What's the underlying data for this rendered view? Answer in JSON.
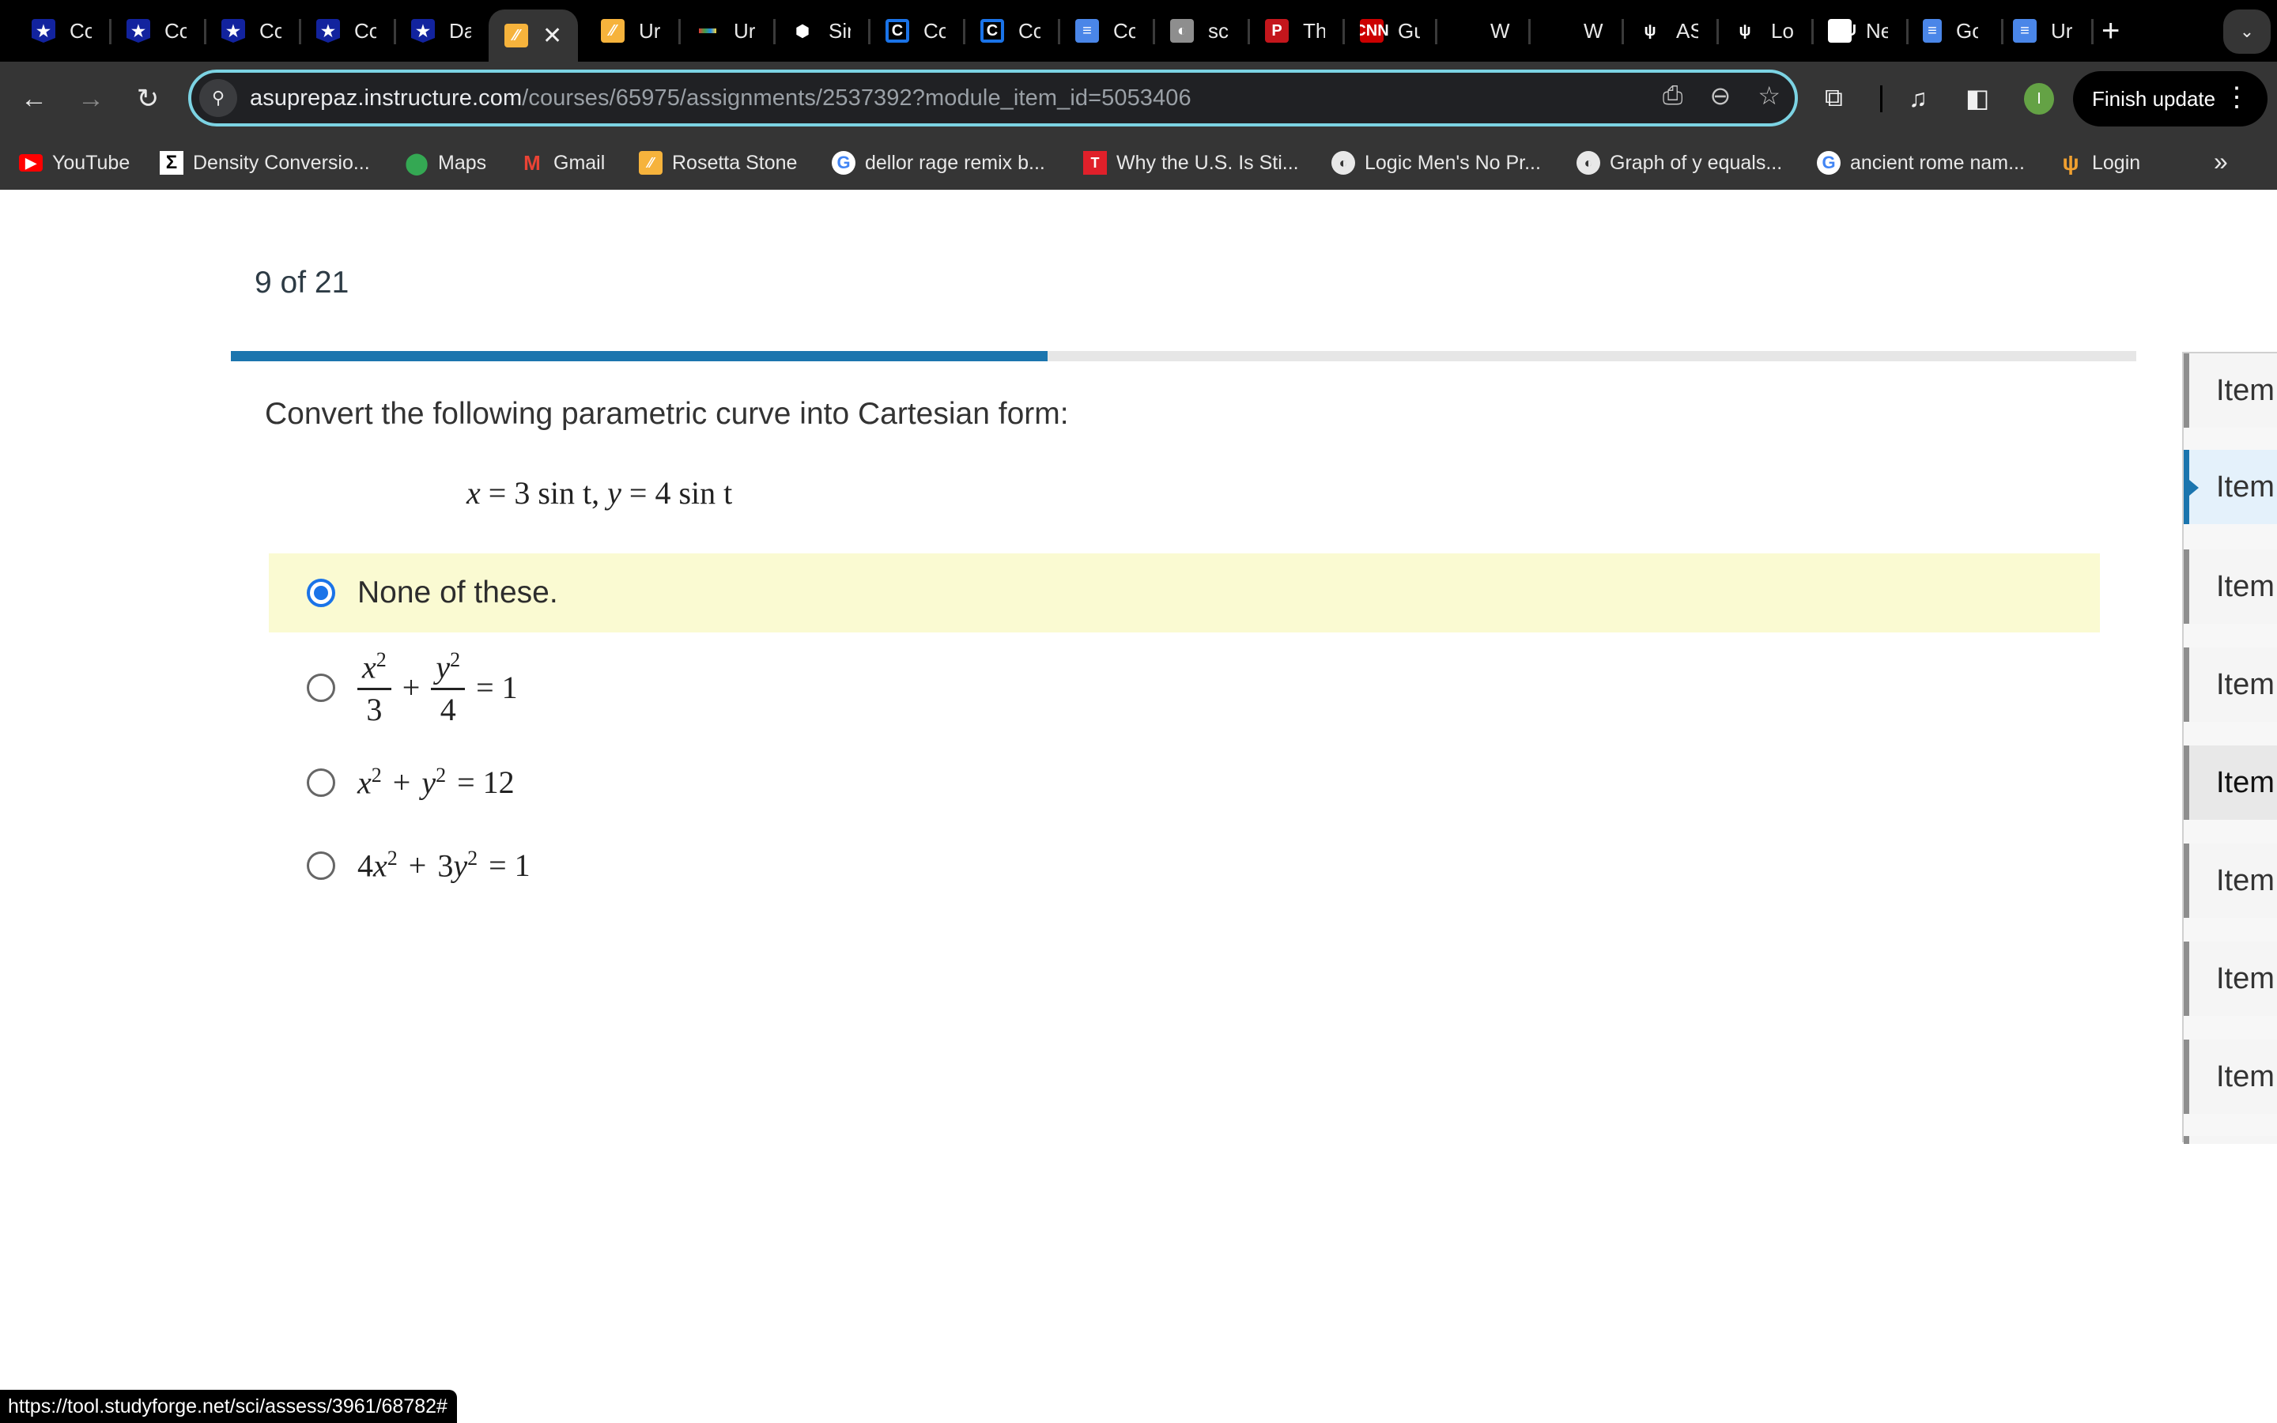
{
  "browser": {
    "tabs": [
      {
        "title": "Co",
        "icon": "canvas-star-icon",
        "active": false
      },
      {
        "title": "Co",
        "icon": "canvas-star-icon",
        "active": false
      },
      {
        "title": "Co",
        "icon": "canvas-star-icon",
        "active": false
      },
      {
        "title": "Co",
        "icon": "canvas-star-icon",
        "active": false
      },
      {
        "title": "Da",
        "icon": "canvas-star-icon",
        "active": false
      },
      {
        "title": "",
        "icon": "rosetta-stone-icon",
        "active": true
      },
      {
        "title": "Ur",
        "icon": "rosetta-stone-icon",
        "active": false
      },
      {
        "title": "Ur",
        "icon": "multicolor-bar-icon",
        "active": false
      },
      {
        "title": "Sir",
        "icon": "hexagon-cluster-icon",
        "active": false
      },
      {
        "title": "Co",
        "icon": "c-circle-icon",
        "active": false
      },
      {
        "title": "Co",
        "icon": "c-circle-icon",
        "active": false
      },
      {
        "title": "Co",
        "icon": "google-docs-icon",
        "active": false
      },
      {
        "title": "sc",
        "icon": "globe-icon",
        "active": false
      },
      {
        "title": "Th",
        "icon": "p-logo-icon",
        "active": false
      },
      {
        "title": "Gu",
        "icon": "cnn-icon",
        "active": false
      },
      {
        "title": "W",
        "icon": "blank-icon",
        "active": false
      },
      {
        "title": "W",
        "icon": "blank-icon",
        "active": false
      },
      {
        "title": "AS",
        "icon": "asu-pitchfork-icon",
        "active": false
      },
      {
        "title": "Lo",
        "icon": "asu-pitchfork-icon",
        "active": false
      },
      {
        "title": "Ne",
        "icon": "asu-logo-icon",
        "active": false
      },
      {
        "title": "Go",
        "icon": "google-docs-file-icon",
        "active": false
      },
      {
        "title": "Ur",
        "icon": "google-docs-icon",
        "active": false
      }
    ],
    "close_glyph": "✕",
    "new_tab_glyph": "+",
    "tab_search_glyph": "⌄",
    "url_host": "asuprepaz.instructure.com",
    "url_path": "/courses/65975/assignments/2537392?module_item_id=5053406",
    "finish_update_label": "Finish update",
    "profile_initial": "I",
    "bookmarks": [
      {
        "label": "YouTube",
        "icon": "youtube-icon"
      },
      {
        "label": "Density Conversio...",
        "icon": "sigma-icon"
      },
      {
        "label": "Maps",
        "icon": "maps-pin-icon"
      },
      {
        "label": "Gmail",
        "icon": "gmail-icon"
      },
      {
        "label": "Rosetta Stone",
        "icon": "rosetta-stone-icon"
      },
      {
        "label": "dellor rage remix b...",
        "icon": "google-icon"
      },
      {
        "label": "Why the U.S. Is Sti...",
        "icon": "t-logo-icon"
      },
      {
        "label": "Logic Men's No Pr...",
        "icon": "globe-icon"
      },
      {
        "label": "Graph of y equals...",
        "icon": "globe-icon"
      },
      {
        "label": "ancient rome nam...",
        "icon": "google-icon"
      },
      {
        "label": "Login",
        "icon": "asu-pitchfork-icon"
      }
    ],
    "bookmarks_overflow_glyph": "»",
    "status_url": "https://tool.studyforge.net/sci/assess/3961/68782#"
  },
  "quiz": {
    "counter": "9 of 21",
    "progress": {
      "current": 9,
      "total": 21,
      "fraction": 0.4286
    },
    "question": "Convert the following parametric curve into Cartesian form:",
    "formula": {
      "x_var": "x",
      "eq": "=",
      "x_expr": "3 sin t",
      "sep": ",",
      "y_var": "y",
      "y_expr": "4 sin t"
    },
    "answers": [
      {
        "label": "None of these.",
        "type": "text",
        "selected": true
      },
      {
        "type": "fraction-sum",
        "t1_num": "x",
        "t1_exp": "2",
        "t1_den": "3",
        "op": "+",
        "t2_num": "y",
        "t2_exp": "2",
        "t2_den": "4",
        "rhs": "= 1",
        "selected": false
      },
      {
        "type": "poly",
        "text_a": "x",
        "exp_a": "2",
        "op": "+",
        "text_b": "y",
        "exp_b": "2",
        "rhs": "= 12",
        "selected": false
      },
      {
        "type": "poly",
        "coef_a": "4",
        "text_a": "x",
        "exp_a": "2",
        "op": "+",
        "coef_b": "3",
        "text_b": "y",
        "exp_b": "2",
        "rhs": "= 1",
        "selected": false
      }
    ],
    "item_nav": [
      {
        "label": "Item",
        "state": "normal"
      },
      {
        "label": "Item",
        "state": "current"
      },
      {
        "label": "Item",
        "state": "normal"
      },
      {
        "label": "Item",
        "state": "normal"
      },
      {
        "label": "Item",
        "state": "hover"
      },
      {
        "label": "Item",
        "state": "normal"
      },
      {
        "label": "Item",
        "state": "normal"
      },
      {
        "label": "Item",
        "state": "normal"
      }
    ]
  },
  "colors": {
    "accent": "#1b75ae",
    "selected_answer_bg": "#fafad2",
    "radio_checked": "#1a73e8",
    "omnibox_focus": "#7cd3e3"
  }
}
